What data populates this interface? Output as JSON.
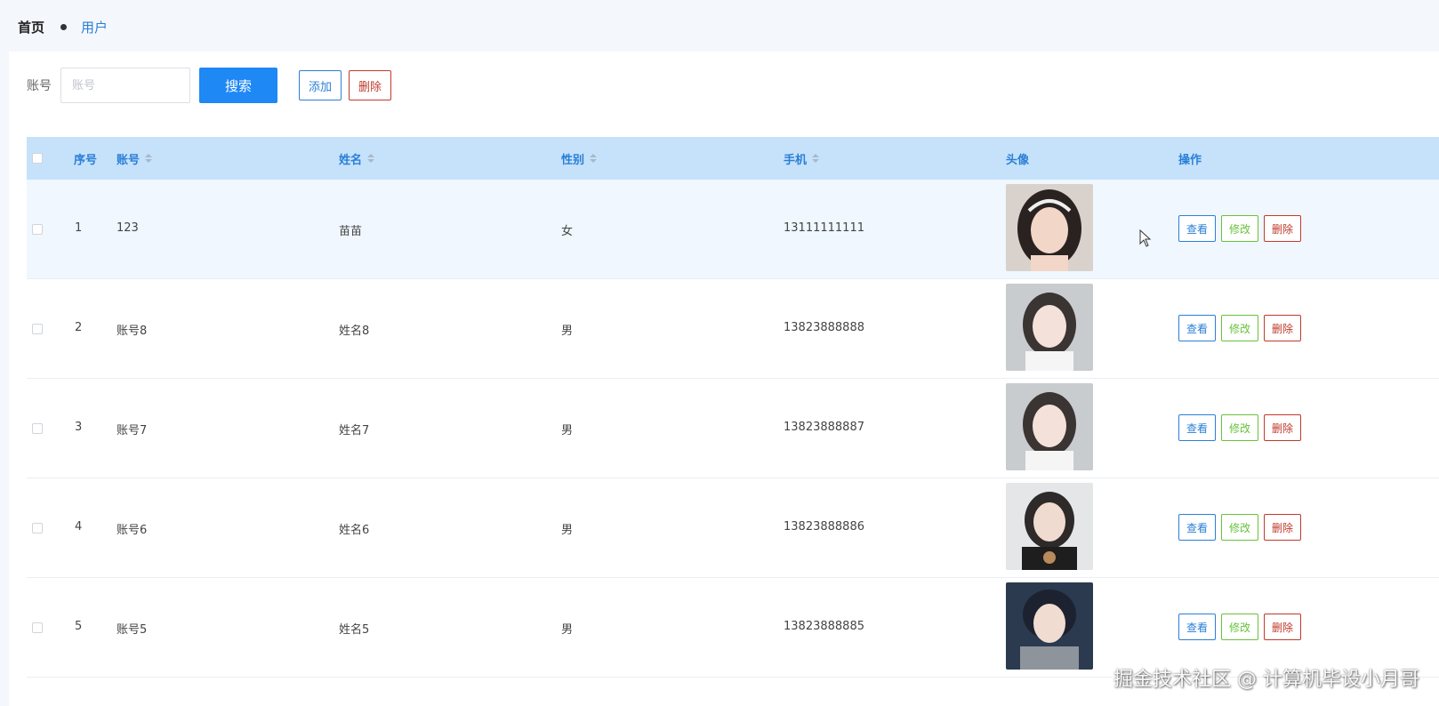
{
  "breadcrumb": {
    "home": "首页",
    "current": "用户"
  },
  "search": {
    "label": "账号",
    "placeholder": "账号",
    "search_button": "搜索",
    "add_button": "添加",
    "delete_button": "删除"
  },
  "table": {
    "columns": [
      "序号",
      "账号",
      "姓名",
      "性别",
      "手机",
      "头像",
      "操作"
    ],
    "rows": [
      {
        "index": "1",
        "account": "123",
        "name": "苗苗",
        "gender": "女",
        "phone": "13111111111"
      },
      {
        "index": "2",
        "account": "账号8",
        "name": "姓名8",
        "gender": "男",
        "phone": "13823888888"
      },
      {
        "index": "3",
        "account": "账号7",
        "name": "姓名7",
        "gender": "男",
        "phone": "13823888887"
      },
      {
        "index": "4",
        "account": "账号6",
        "name": "姓名6",
        "gender": "男",
        "phone": "13823888886"
      },
      {
        "index": "5",
        "account": "账号5",
        "name": "姓名5",
        "gender": "男",
        "phone": "13823888885"
      }
    ],
    "actions": {
      "view": "查看",
      "edit": "修改",
      "delete": "删除"
    }
  },
  "watermark": "掘金技术社区 @ 计算机毕设小月哥",
  "colors": {
    "primary": "#1e88f5",
    "header_bg": "#c6e2fb",
    "danger": "#c0392b",
    "success": "#67c23a"
  }
}
